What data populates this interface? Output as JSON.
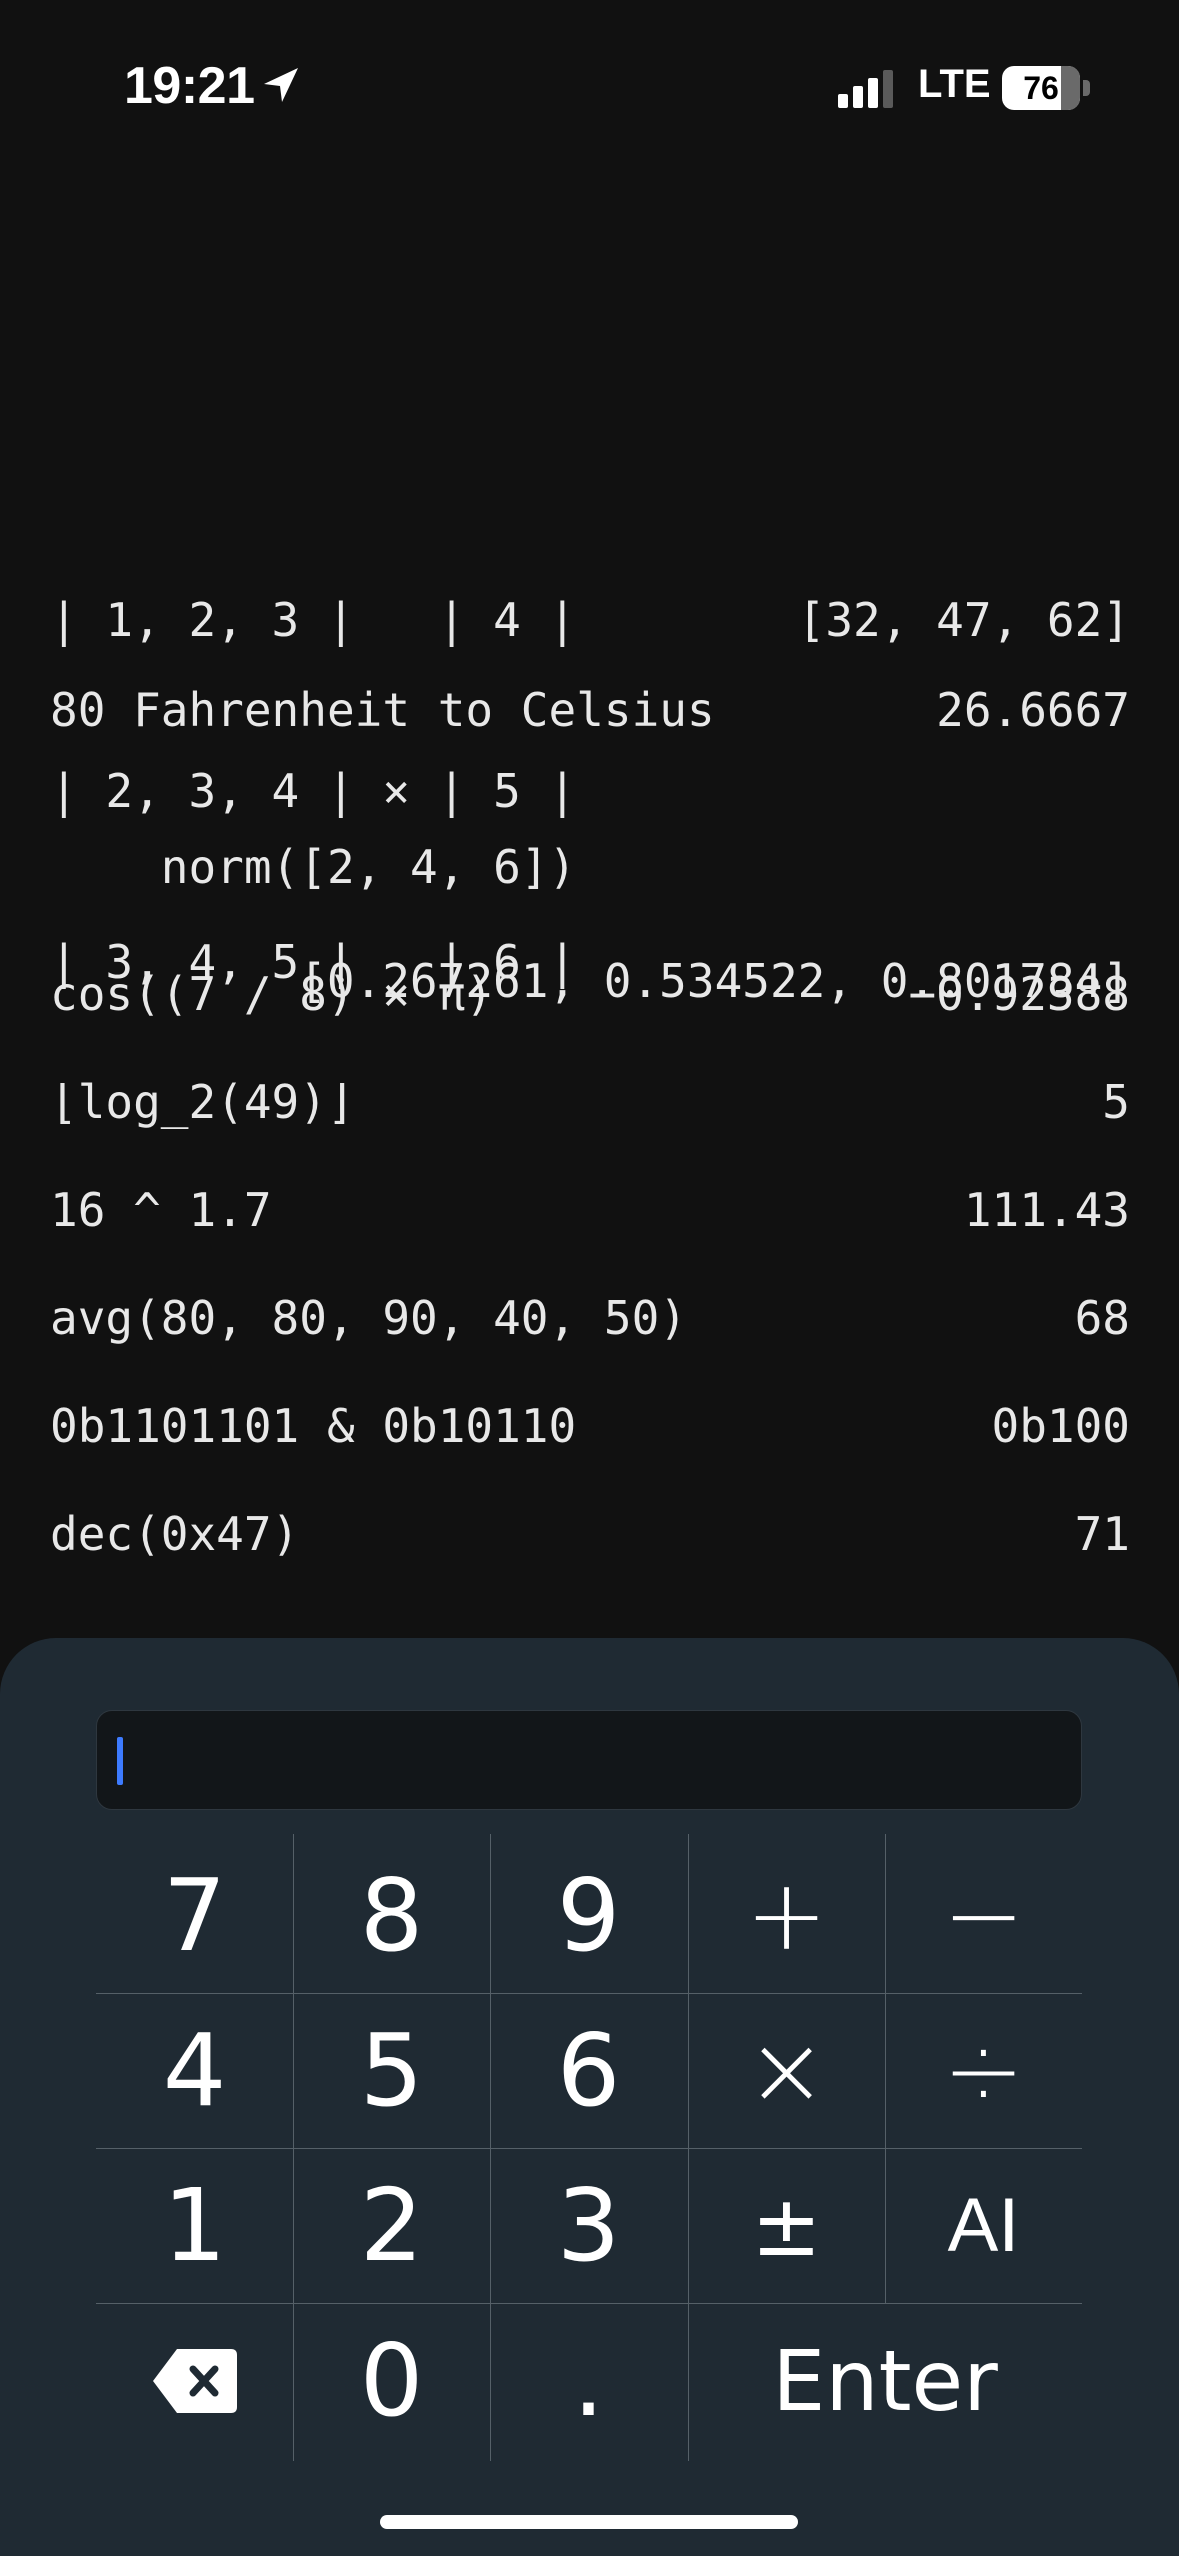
{
  "status_bar": {
    "time": "19:21",
    "network": "LTE",
    "battery_percent": "76",
    "battery_level": 0.76,
    "signal_bars_active": 3,
    "icons": [
      "location-arrow-icon",
      "cellular-signal-icon",
      "battery-icon"
    ]
  },
  "history": {
    "matrix": {
      "lines": [
        "| 1, 2, 3 |   | 4 |",
        "| 2, 3, 4 | × | 5 |",
        "| 3, 4, 5 |   | 6 |"
      ],
      "result": "[32, 47, 62]"
    },
    "entries": [
      {
        "expr": "80 Fahrenheit to Celsius",
        "result": "26.6667"
      },
      {
        "expr": "norm([2, 4, 6])",
        "result": "[0.267261, 0.534522, 0.801784]"
      },
      {
        "expr": "cos((7 / 8) × π)",
        "result": "−0.92388"
      },
      {
        "expr": "⌊log_2(49)⌋",
        "result": "5"
      },
      {
        "expr": "16 ^ 1.7",
        "result": "111.43"
      },
      {
        "expr": "avg(80, 80, 90, 40, 50)",
        "result": "68"
      },
      {
        "expr": "0b1101101 & 0b10110",
        "result": "0b100"
      },
      {
        "expr": "dec(0x47)",
        "result": "71"
      }
    ]
  },
  "input": {
    "value": "",
    "placeholder": ""
  },
  "keypad": {
    "row1": [
      "7",
      "8",
      "9",
      "+",
      "−"
    ],
    "row2": [
      "4",
      "5",
      "6",
      "×",
      "÷"
    ],
    "row3": [
      "1",
      "2",
      "3",
      "±",
      "AI"
    ],
    "row4": {
      "backspace_icon": "backspace-icon",
      "zero": "0",
      "dot": ".",
      "enter": "Enter"
    }
  },
  "colors": {
    "background": "#111111",
    "panel": "#1f2a33",
    "caret": "#3d7bff",
    "text": "#e8e8e8"
  }
}
